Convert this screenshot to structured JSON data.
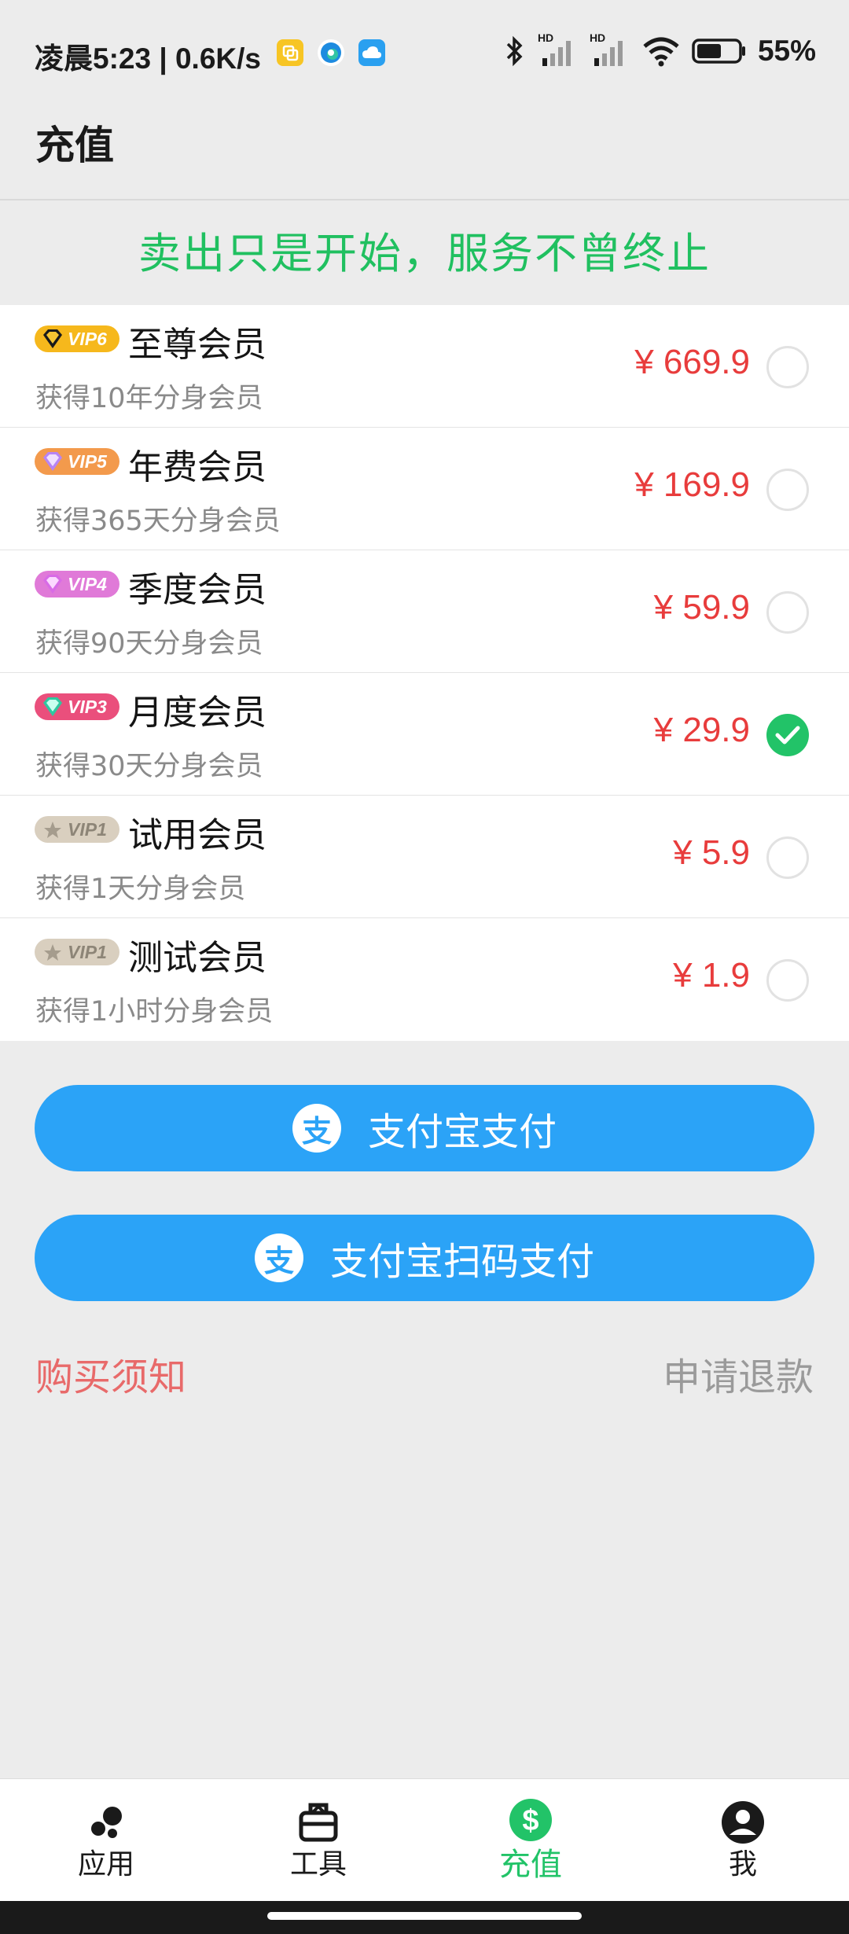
{
  "status_bar": {
    "time_speed": "凌晨5:23 | 0.6K/s",
    "network_label_1": "HD",
    "network_label_2": "HD",
    "battery": "55%"
  },
  "header": {
    "title": "充值"
  },
  "slogan": "卖出只是开始，服务不曾终止",
  "plans": [
    {
      "badge": "VIP6",
      "name": "至尊会员",
      "desc": "获得10年分身会员",
      "price": "¥ 669.9",
      "selected": false,
      "badge_color": "#f6b81c"
    },
    {
      "badge": "VIP5",
      "name": "年费会员",
      "desc": "获得365天分身会员",
      "price": "¥ 169.9",
      "selected": false,
      "badge_color": "#f39a4c"
    },
    {
      "badge": "VIP4",
      "name": "季度会员",
      "desc": "获得90天分身会员",
      "price": "¥ 59.9",
      "selected": false,
      "badge_color": "#e07ad8"
    },
    {
      "badge": "VIP3",
      "name": "月度会员",
      "desc": "获得30天分身会员",
      "price": "¥ 29.9",
      "selected": true,
      "badge_color": "#ea4f7c"
    },
    {
      "badge": "VIP1",
      "name": "试用会员",
      "desc": "获得1天分身会员",
      "price": "¥ 5.9",
      "selected": false,
      "badge_color": "#d9cfbf"
    },
    {
      "badge": "VIP1",
      "name": "测试会员",
      "desc": "获得1小时分身会员",
      "price": "¥ 1.9",
      "selected": false,
      "badge_color": "#d9cfbf"
    }
  ],
  "buttons": {
    "alipay": "支付宝支付",
    "alipay_scan": "支付宝扫码支付",
    "alipay_glyph": "支"
  },
  "links": {
    "notice": "购买须知",
    "refund": "申请退款"
  },
  "nav": [
    {
      "label": "应用",
      "icon": "apps-icon",
      "active": false
    },
    {
      "label": "工具",
      "icon": "toolbox-icon",
      "active": false
    },
    {
      "label": "充值",
      "icon": "dollar-icon",
      "active": true
    },
    {
      "label": "我",
      "icon": "profile-icon",
      "active": false
    }
  ],
  "colors": {
    "accent_green": "#22c368",
    "price_red": "#e83c3c",
    "button_blue": "#2ba3f7",
    "notice_red": "#e86a6a"
  }
}
